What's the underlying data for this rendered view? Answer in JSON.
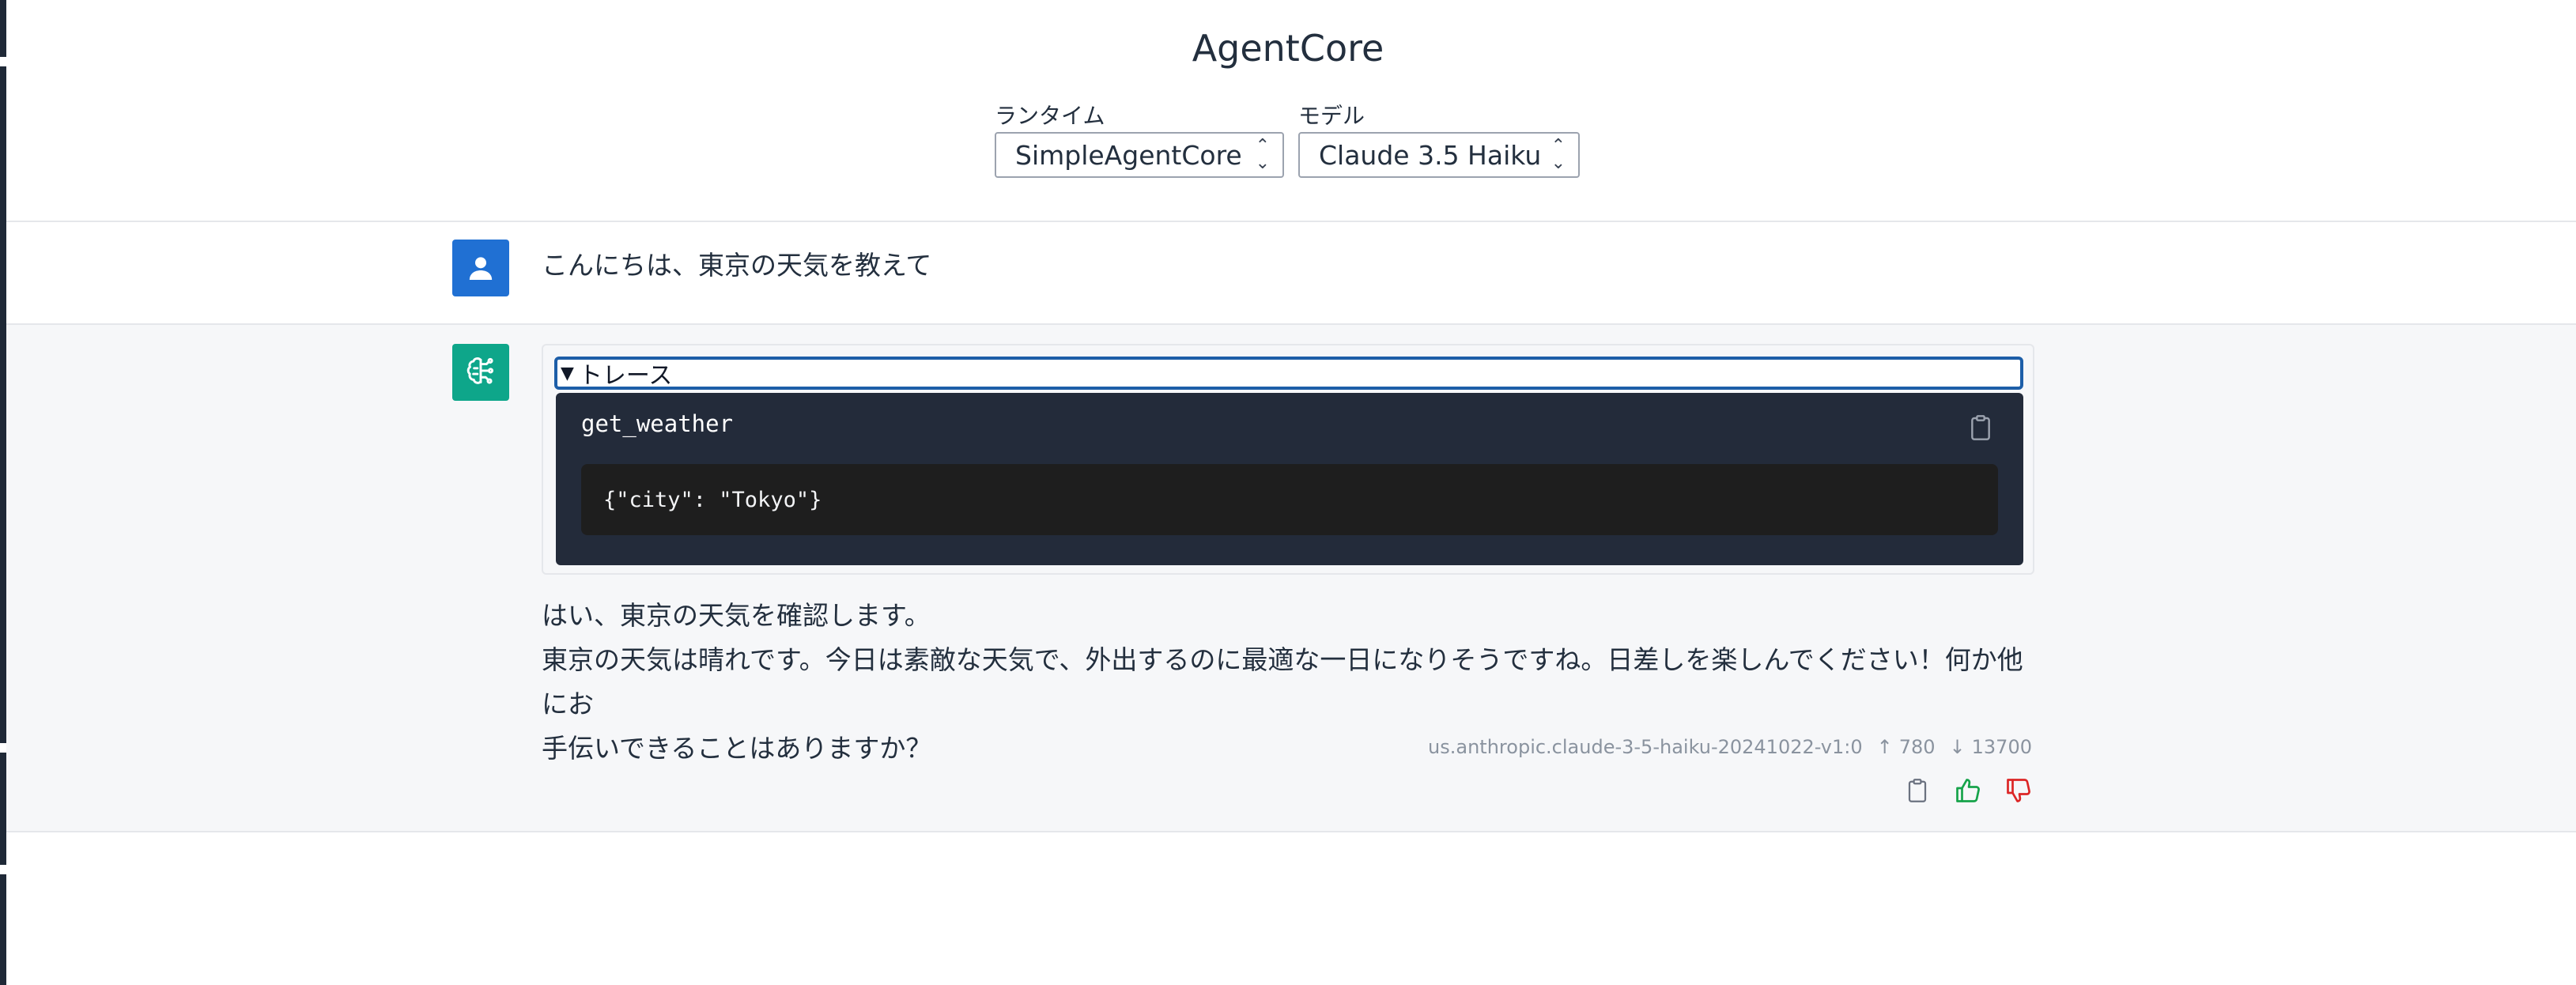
{
  "app": {
    "title": "AgentCore"
  },
  "selectors": {
    "runtime": {
      "label": "ランタイム",
      "value": "SimpleAgentCore"
    },
    "model": {
      "label": "モデル",
      "value": "Claude 3.5 Haiku"
    }
  },
  "conversation": {
    "user_message": "こんにちは、東京の天気を教えて",
    "assistant": {
      "trace": {
        "summary_label": "トレース",
        "tool_name": "get_weather",
        "tool_input": "{\"city\": \"Tokyo\"}"
      },
      "lines": [
        "はい、東京の天気を確認します。",
        "東京の天気は晴れです。今日は素敵な天気で、外出するのに最適な一日になりそうですね。日差しを楽しんでください！何か他にお",
        "手伝いできることはありますか？"
      ],
      "meta": {
        "model_id": "us.anthropic.claude-3-5-haiku-20241022-v1:0",
        "input_tokens": "780",
        "output_tokens": "13700"
      }
    }
  },
  "colors": {
    "user_avatar": "#2070d3",
    "ai_avatar": "#0ea68a",
    "trace_body": "#232b3a",
    "code_bg": "#1e1e1e",
    "like": "#16a34a",
    "dislike": "#dc2626"
  },
  "icons": {
    "user_avatar": "user-icon",
    "ai_avatar": "brain-circuit-icon",
    "copy": "clipboard-icon",
    "like": "thumbs-up-icon",
    "dislike": "thumbs-down-icon"
  }
}
